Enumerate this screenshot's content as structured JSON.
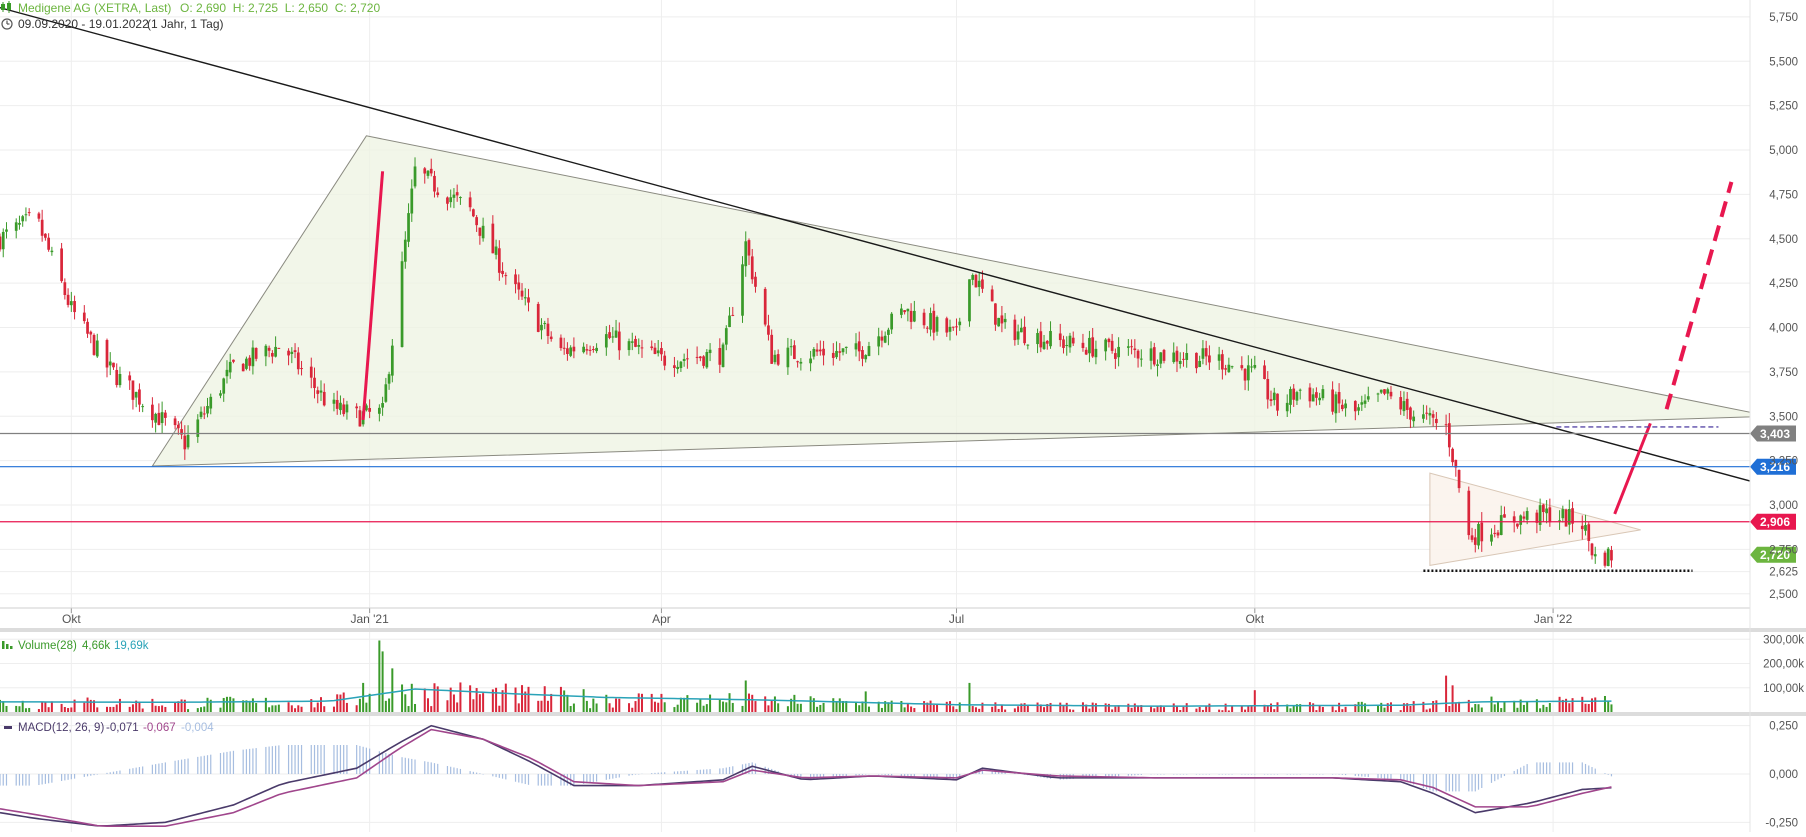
{
  "header": {
    "instrument": "Medigene AG (XETRA, Last)",
    "ohlc": "O: 2,690  H: 2,725  L: 2,650  C: 2,720",
    "period": "09.09.2020 - 19.01.2022",
    "interval": "(1 Jahr, 1 Tag)"
  },
  "colors": {
    "up": "#3a9a2a",
    "down": "#d9263a",
    "accent_red": "#e8174f",
    "blue_line": "#1f6fd6",
    "grid": "#eeeeee",
    "axis_text": "#555555",
    "volume_avg": "#2aa3b8",
    "macd": "#4a3a6a",
    "signal": "#a0468c",
    "hist": "#a6bde0"
  },
  "chart_data": [
    {
      "type": "line",
      "panel": "price",
      "title": "Medigene AG (XETRA, Last)",
      "x_range": [
        "2020-09-09",
        "2022-03-20"
      ],
      "ylim": [
        2.42,
        5.8
      ],
      "y_ticks": [
        "5,750",
        "5,500",
        "5,250",
        "5,000",
        "4,750",
        "4,500",
        "4,250",
        "4,000",
        "3,750",
        "3,500",
        "3,250",
        "3,000",
        "2,750",
        "2,625",
        "2,500"
      ],
      "x_ticks": [
        "Okt",
        "Jan '21",
        "Apr",
        "Jul",
        "Okt",
        "Jan '22"
      ],
      "close_series": {
        "x": [
          "2020-09-09",
          "2020-09-20",
          "2020-10-01",
          "2020-10-12",
          "2020-10-25",
          "2020-11-05",
          "2020-11-20",
          "2020-12-05",
          "2020-12-20",
          "2020-12-28",
          "2021-01-05",
          "2021-01-15",
          "2021-02-01",
          "2021-02-15",
          "2021-03-01",
          "2021-03-15",
          "2021-04-01",
          "2021-04-20",
          "2021-04-27",
          "2021-05-05",
          "2021-05-20",
          "2021-06-01",
          "2021-06-15",
          "2021-07-01",
          "2021-07-05",
          "2021-07-15",
          "2021-08-01",
          "2021-08-15",
          "2021-09-01",
          "2021-09-20",
          "2021-10-01",
          "2021-10-08",
          "2021-10-15",
          "2021-11-01",
          "2021-11-10",
          "2021-11-20",
          "2021-11-29",
          "2021-12-01",
          "2021-12-06",
          "2021-12-10",
          "2021-12-20",
          "2021-12-31",
          "2022-01-10",
          "2022-01-14",
          "2022-01-19"
        ],
        "values": [
          4.5,
          4.62,
          4.1,
          3.78,
          3.55,
          3.35,
          3.78,
          3.9,
          3.55,
          3.5,
          3.52,
          4.88,
          4.66,
          4.2,
          3.86,
          3.95,
          3.82,
          3.85,
          4.47,
          3.84,
          3.86,
          3.86,
          4.1,
          3.95,
          4.33,
          4.0,
          3.92,
          3.88,
          3.85,
          3.82,
          3.73,
          3.55,
          3.65,
          3.52,
          3.62,
          3.5,
          3.44,
          3.28,
          2.82,
          2.85,
          2.92,
          2.95,
          2.9,
          2.7,
          2.72
        ]
      },
      "horizontal_levels": [
        {
          "value": 3.403,
          "label": "3,403",
          "color": "#808080"
        },
        {
          "value": 3.216,
          "label": "3,216",
          "color": "#1f6fd6"
        },
        {
          "value": 2.906,
          "label": "2,906",
          "color": "#e8174f"
        },
        {
          "value": 2.72,
          "label": "2,720",
          "color": "#6cb53f"
        }
      ],
      "drawings": {
        "trend_line": [
          [
            "2020-08-10",
            5.95
          ],
          [
            "2022-03-20",
            3.05
          ]
        ],
        "triangle": [
          [
            "2020-10-26",
            3.22
          ],
          [
            "2020-12-31",
            5.08
          ],
          [
            "2022-03-09",
            3.5
          ]
        ],
        "small_triangle": [
          [
            "2021-11-24",
            3.18
          ],
          [
            "2022-01-28",
            2.86
          ],
          [
            "2021-11-24",
            2.66
          ]
        ],
        "red_segment": [
          [
            "2020-12-30",
            3.48
          ],
          [
            "2021-01-05",
            4.88
          ]
        ],
        "red_segment_2": [
          [
            "2022-01-20",
            2.95
          ],
          [
            "2022-01-31",
            3.46
          ]
        ],
        "dashed_projection": [
          [
            "2022-02-05",
            3.54
          ],
          [
            "2022-02-25",
            4.82
          ]
        ],
        "dashed_level": {
          "value": 3.44,
          "from": "2022-01-02",
          "to": "2022-02-21"
        },
        "dotted_support": {
          "value": 2.63,
          "from": "2021-11-22",
          "to": "2022-02-13"
        }
      }
    },
    {
      "type": "bar",
      "panel": "volume",
      "title": "Volume(28)",
      "values_label": [
        "4,66k",
        "19,69k"
      ],
      "ylim": [
        0,
        330000
      ],
      "y_ticks": [
        "300,00k",
        "200,00k",
        "100,00k"
      ],
      "spikes": {
        "x": [
          "2020-12-30",
          "2021-01-04",
          "2021-01-05",
          "2021-01-08",
          "2021-04-27",
          "2021-06-03",
          "2021-07-05",
          "2021-10-01",
          "2021-11-29",
          "2021-12-01",
          "2022-01-14"
        ],
        "values": [
          120000,
          295000,
          250000,
          180000,
          130000,
          85000,
          120000,
          90000,
          150000,
          110000,
          60000
        ]
      },
      "average": {
        "x": [
          "2020-09-09",
          "2020-11-01",
          "2020-12-20",
          "2021-01-15",
          "2021-02-15",
          "2021-03-15",
          "2021-05-01",
          "2021-07-01",
          "2021-09-01",
          "2021-11-15",
          "2021-12-10",
          "2022-01-19"
        ],
        "values": [
          42000,
          40000,
          45000,
          95000,
          75000,
          60000,
          50000,
          30000,
          24000,
          28000,
          42000,
          45000
        ]
      }
    },
    {
      "type": "line",
      "panel": "macd",
      "title": "MACD(12, 26, 9)",
      "values_label": [
        "-0,071",
        "-0,067",
        "-0,004"
      ],
      "ylim": [
        -0.3,
        0.3
      ],
      "y_ticks": [
        "0,250",
        "0,000",
        "-0,250"
      ],
      "x": [
        "2020-09-09",
        "2020-09-20",
        "2020-10-10",
        "2020-10-30",
        "2020-11-20",
        "2020-12-05",
        "2020-12-28",
        "2021-01-10",
        "2021-01-20",
        "2021-02-05",
        "2021-02-20",
        "2021-03-05",
        "2021-03-25",
        "2021-04-20",
        "2021-04-29",
        "2021-05-15",
        "2021-06-05",
        "2021-07-01",
        "2021-07-09",
        "2021-08-01",
        "2021-09-01",
        "2021-10-05",
        "2021-10-25",
        "2021-11-15",
        "2021-11-25",
        "2021-12-08",
        "2021-12-25",
        "2022-01-10",
        "2022-01-19"
      ],
      "series": [
        {
          "name": "MACD",
          "values": [
            -0.2,
            -0.23,
            -0.27,
            -0.25,
            -0.16,
            -0.05,
            0.03,
            0.16,
            0.25,
            0.18,
            0.06,
            -0.06,
            -0.06,
            -0.03,
            0.04,
            -0.03,
            -0.01,
            -0.03,
            0.03,
            -0.02,
            -0.02,
            -0.02,
            -0.02,
            -0.04,
            -0.1,
            -0.2,
            -0.15,
            -0.08,
            -0.071
          ]
        },
        {
          "name": "Signal",
          "values": [
            -0.18,
            -0.21,
            -0.27,
            -0.27,
            -0.2,
            -0.1,
            -0.02,
            0.13,
            0.23,
            0.18,
            0.08,
            -0.04,
            -0.06,
            -0.04,
            0.02,
            -0.02,
            -0.01,
            -0.02,
            0.02,
            -0.01,
            -0.02,
            -0.02,
            -0.02,
            -0.03,
            -0.07,
            -0.17,
            -0.17,
            -0.1,
            -0.067
          ]
        }
      ]
    }
  ]
}
